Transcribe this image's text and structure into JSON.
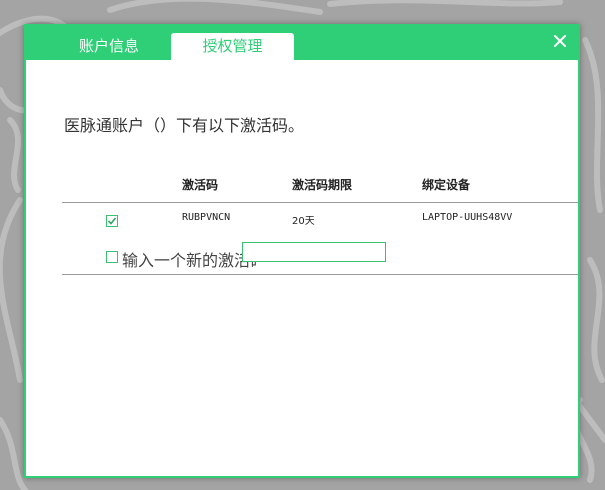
{
  "tabs": {
    "account_info": "账户信息",
    "auth_management": "授权管理"
  },
  "close_icon": "close-icon",
  "intro_text": "医脉通账户（）下有以下激活码。",
  "table": {
    "headers": [
      "激活码",
      "激活码期限",
      "绑定设备"
    ],
    "rows": [
      {
        "checked": true,
        "code": "RUBPVNCN",
        "period": "20天",
        "device": "LAPTOP-UUHS48VV"
      }
    ]
  },
  "new_code": {
    "checked": false,
    "label": "输入一个新的激活码",
    "value": ""
  },
  "colors": {
    "accent": "#2fcf78",
    "background": "#a4a4a4"
  }
}
